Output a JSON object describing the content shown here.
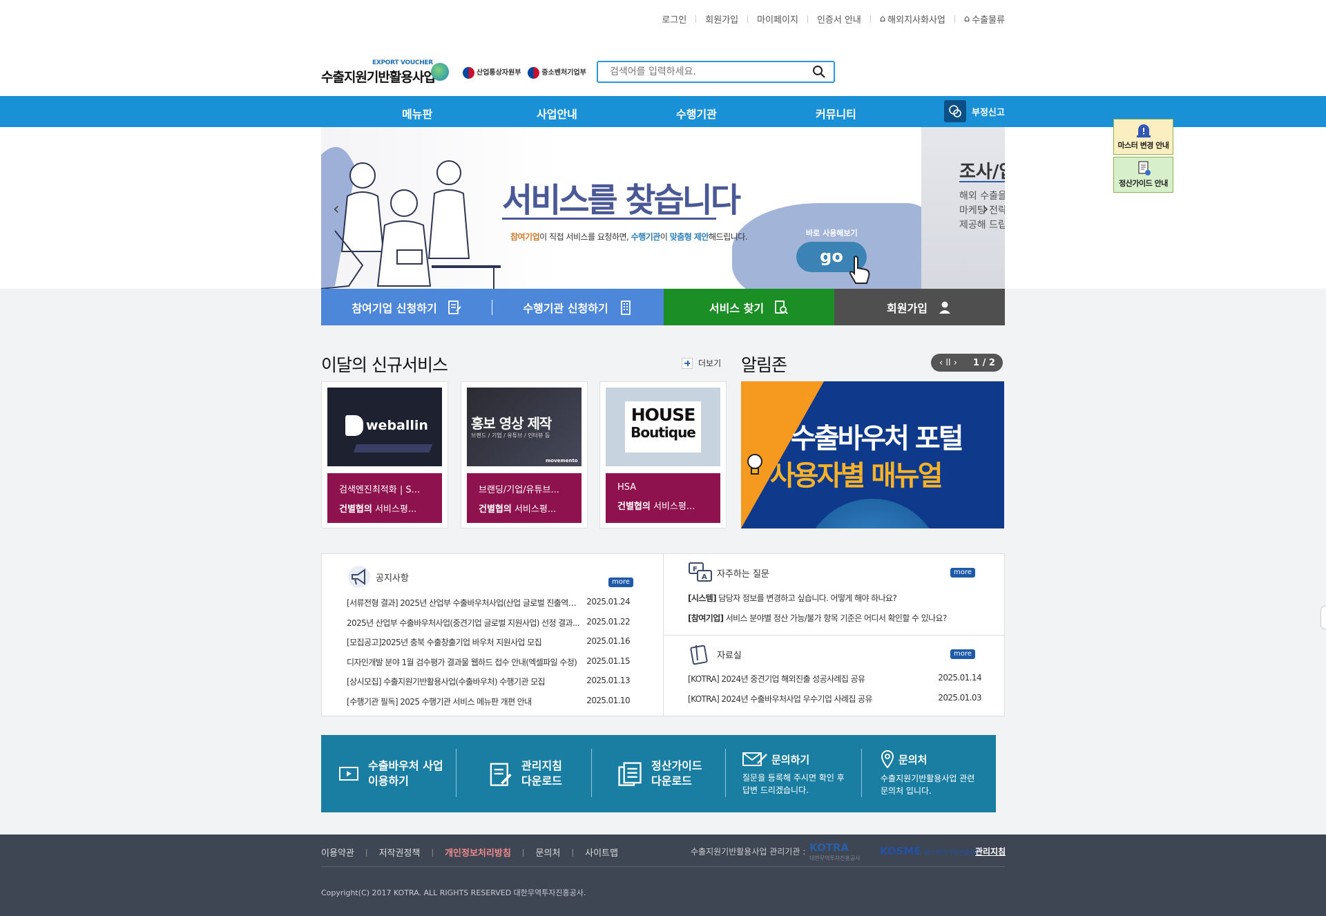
{
  "util_nav": {
    "items": [
      "로그인",
      "회원가입",
      "마이페이지",
      "인증서 안내",
      "해외지사화사업",
      "수출물류"
    ]
  },
  "logo": {
    "small": "EXPORT VOUCHER",
    "main": "수출지원기반활용사업"
  },
  "gov": {
    "ministry1": "산업통상자원부",
    "ministry2": "중소벤처기업부"
  },
  "search": {
    "placeholder": "검색어를 입력하세요."
  },
  "nav": {
    "items": [
      "메뉴판",
      "사업안내",
      "수행기관",
      "커뮤니티"
    ],
    "report": "부정신고"
  },
  "side": {
    "master_change": "마스터 변경 안내",
    "settle_guide": "정산가이드 안내"
  },
  "banner": {
    "headline": "서비스를 찾습니다",
    "sub_org": "참여기업",
    "sub_mid": "이 직접 서비스를 요청하면, ",
    "sub_agency": "수행기관",
    "sub_mid2": "이 ",
    "sub_custom": "맞춤형 제안",
    "sub_end": "해드립니다.",
    "try_label": "바로 사용해보기",
    "go_label": "go",
    "next_title": "조사/압",
    "next_desc": [
      "해외 수출을",
      "마케팅 전략",
      "제공해 드립"
    ]
  },
  "quick": {
    "q1": "참여기업 신청하기",
    "q2": "수행기관 신청하기",
    "q3": "서비스 찾기",
    "q4": "회원가입"
  },
  "services": {
    "title": "이달의 신규서비스",
    "more": "더보기",
    "cards": [
      {
        "thumb": "weballin",
        "line1": "검색엔진최적화 | S...",
        "line2_bold": "건별협의",
        "line2": " 서비스평..."
      },
      {
        "thumb": "홍보 영상 제작",
        "thumb_sub": "브랜드 / 기업 / 유튜브 / 인터뷰 등",
        "thumb_brand": "movemento",
        "line1": "브랜딩/기업/유튜브...",
        "line2_bold": "건별협의",
        "line2": " 서비스평..."
      },
      {
        "thumb": "HOUSE",
        "thumb2": "Boutique",
        "line1": "HSA",
        "line2_bold": "건별협의",
        "line2": " 서비스평..."
      }
    ]
  },
  "alimzone": {
    "title": "알림존",
    "page": "1 / 2",
    "banner_line1": "수출바우처 포털",
    "banner_line2": "사용자별 매뉴얼"
  },
  "notices": {
    "title": "공지사항",
    "more": "more",
    "rows": [
      {
        "title": "[서류전형 결과] 2025년 산업부 수출바우처사업(산업 글로벌 진출역량...",
        "date": "2025.01.24"
      },
      {
        "title": "2025년 산업부 수출바우처사업(중견기업 글로벌 지원사업) 선정 결과...",
        "date": "2025.01.22"
      },
      {
        "title": "[모집공고]2025년 충북 수출창출기업 바우처 지원사업 모집",
        "date": "2025.01.16"
      },
      {
        "title": "디자인개발 분야 1월 검수평가 결과물 웹하드 접수 안내(엑셀파일 수정)",
        "date": "2025.01.15"
      },
      {
        "title": "[상시모집] 수출지원기반활용사업(수출바우처) 수행기관 모집",
        "date": "2025.01.13"
      },
      {
        "title": "[수행기관 필독] 2025 수행기관 서비스 메뉴판 개편 안내",
        "date": "2025.01.10"
      }
    ]
  },
  "faq": {
    "title": "자주하는 질문",
    "more": "more",
    "rows": [
      {
        "tag": "[시스템]",
        "text": " 담당자 정보를 변경하고 싶습니다. 어떻게 해야 하나요?"
      },
      {
        "tag": "[참여기업]",
        "text": " 서비스 분야별 정산 가능/불가 항목 기준은 어디서 확인할 수 있나요?"
      }
    ]
  },
  "archive": {
    "title": "자료실",
    "more": "more",
    "rows": [
      {
        "title": "[KOTRA] 2024년 중견기업 해외진출 성공사례집 공유",
        "date": "2025.01.14"
      },
      {
        "title": "[KOTRA] 2024년 수출바우처사업 우수기업 사례집 공유",
        "date": "2025.01.03"
      }
    ]
  },
  "info": {
    "b1_l1": "수출바우처 사업",
    "b1_l2": "이용하기",
    "b2_l1": "관리지침",
    "b2_l2": "다운로드",
    "b3_l1": "정산가이드",
    "b3_l2": "다운로드",
    "b4_title": "문의하기",
    "b4_d1": "질문을 등록해 주시면 확인 후",
    "b4_d2": "답변 드리겠습니다.",
    "b5_title": "문의처",
    "b5_d1": "수출지원기반활용사업 관련",
    "b5_d2": "문의처 입니다."
  },
  "footer": {
    "links": [
      "이용약관",
      "저작권정책",
      "개인정보처리방침",
      "문의처",
      "사이트맵"
    ],
    "mgr": "수출지원기반활용사업 관리기관 :",
    "kotra": "KOTRA",
    "kotra_sub": "대한무역투자진흥공사",
    "kosme": "KOSME",
    "kosme_sub": "중소벤처기업진흥공단",
    "guide": "관리지침",
    "copyright": "Copyright(C) 2017 KOTRA. ALL RIGHTS RESERVED 대한무역투자진흥공사."
  },
  "colors": {
    "nav_blue": "#1a91d6",
    "quick_blue": "#4c87d9",
    "quick_green": "#1b8f25",
    "quick_gray": "#4f4f4f",
    "card_caption": "#8d124e",
    "info_teal": "#1a7ea2",
    "footer_bg": "#3e4553"
  }
}
